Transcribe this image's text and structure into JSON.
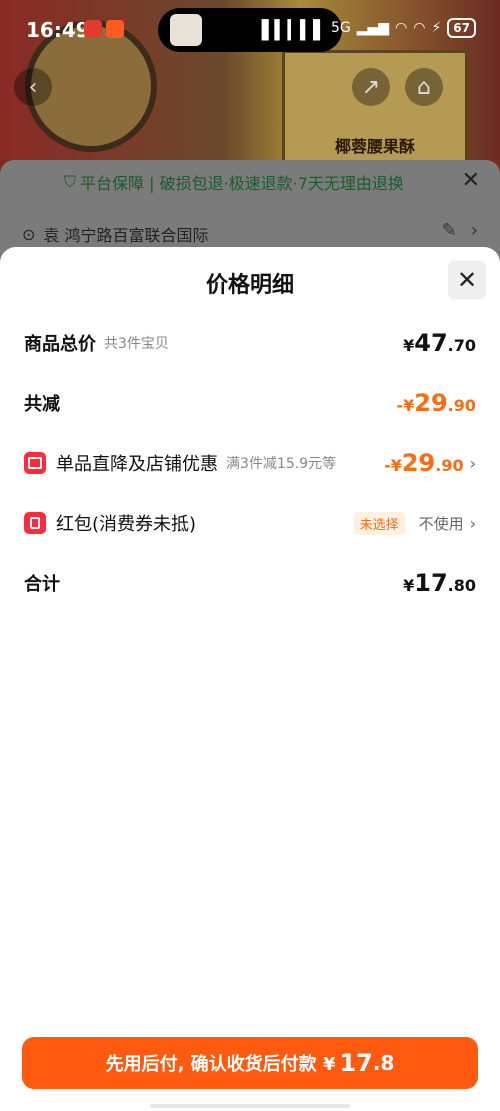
{
  "status_bar": {
    "time": "16:49",
    "network": "5G",
    "battery": "67"
  },
  "background": {
    "box_title": "椰蓉腰果酥",
    "guarantee": "平台保障 | 破损包退·极速退款·7天无理由退换",
    "address": "袁 鸿宁路百富联合国际"
  },
  "sheet": {
    "title": "价格明细",
    "rows": [
      {
        "label": "商品总价",
        "sub": "共3件宝贝",
        "symbol": "¥",
        "integer": "47",
        "decimal": ".70"
      },
      {
        "label": "共减",
        "symbol": "-¥",
        "integer": "29",
        "decimal": ".90"
      },
      {
        "label": "单品直降及店铺优惠",
        "sub": "满3件减15.9元等",
        "symbol": "-¥",
        "integer": "29",
        "decimal": ".90"
      },
      {
        "label": "红包(消费券未抵)",
        "badge": "未选择",
        "action": "不使用"
      },
      {
        "label": "合计",
        "symbol": "¥",
        "integer": "17",
        "decimal": ".80"
      }
    ]
  },
  "cta": {
    "label": "先用后付, 确认收货后付款 ¥",
    "amount_integer": "17",
    "amount_decimal": ".8"
  },
  "colors": {
    "accent": "#ff6a13",
    "cta": "#ff5a0f",
    "icon_red": "#ff2a3a"
  }
}
